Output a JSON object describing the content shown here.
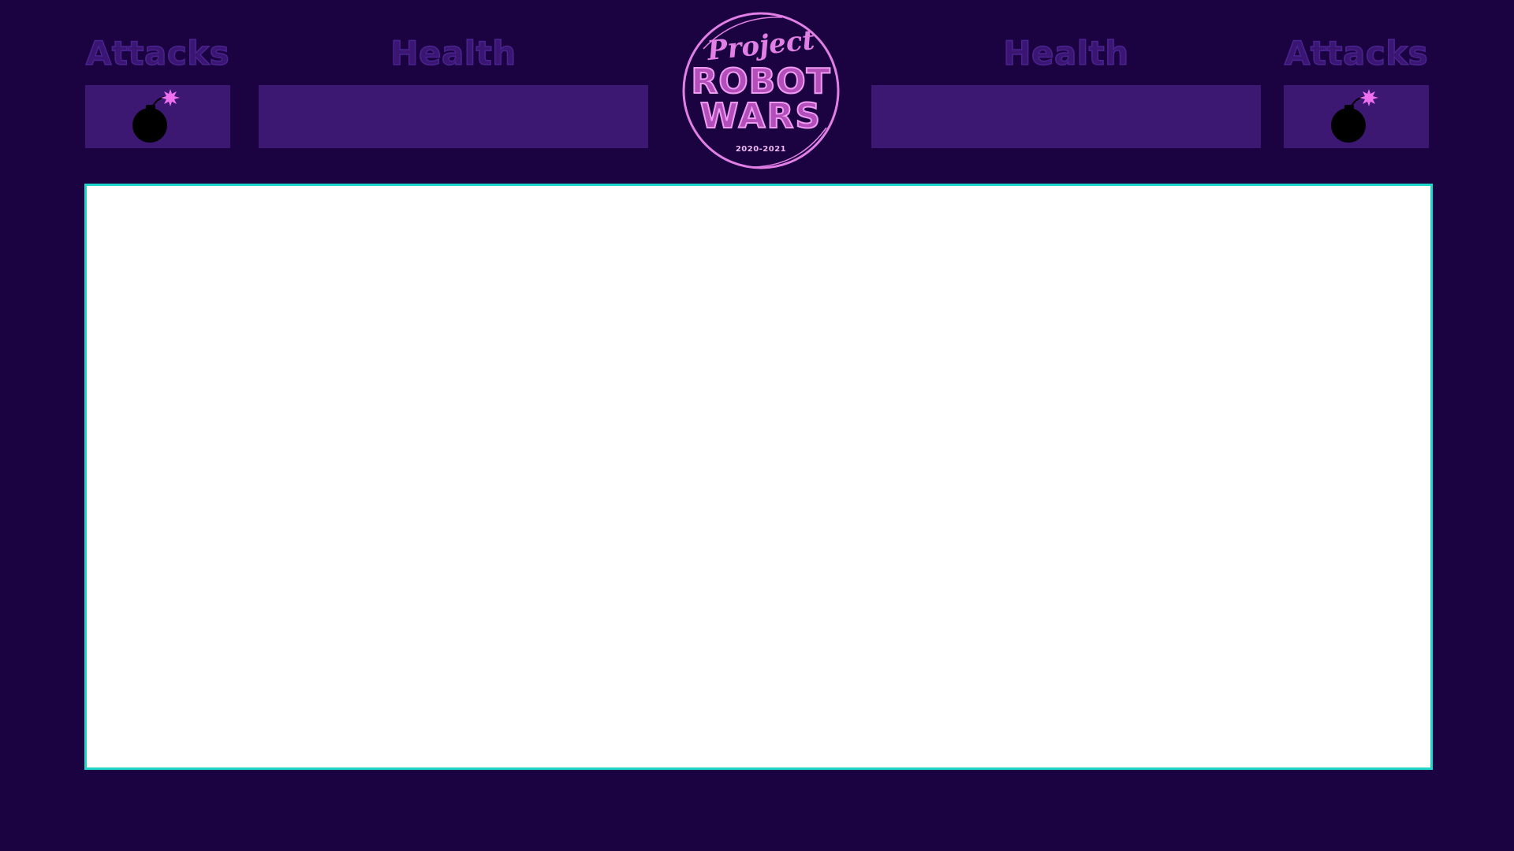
{
  "player_left": {
    "attacks_label": "Attacks",
    "health_label": "Health",
    "attack_item_icon": "bomb-icon"
  },
  "player_right": {
    "attacks_label": "Attacks",
    "health_label": "Health",
    "attack_item_icon": "bomb-icon"
  },
  "logo": {
    "line1": "Project",
    "line2": "ROBOT",
    "line3": "WARS",
    "years": "2020-2021"
  },
  "colors": {
    "background": "#1a0340",
    "panel": "#3c1873",
    "label": "#3a1672",
    "logo_accent": "#e27fe6",
    "spark": "#ee6ff0",
    "arena_border": "#1fd6c8",
    "arena_fill": "#ffffff"
  }
}
